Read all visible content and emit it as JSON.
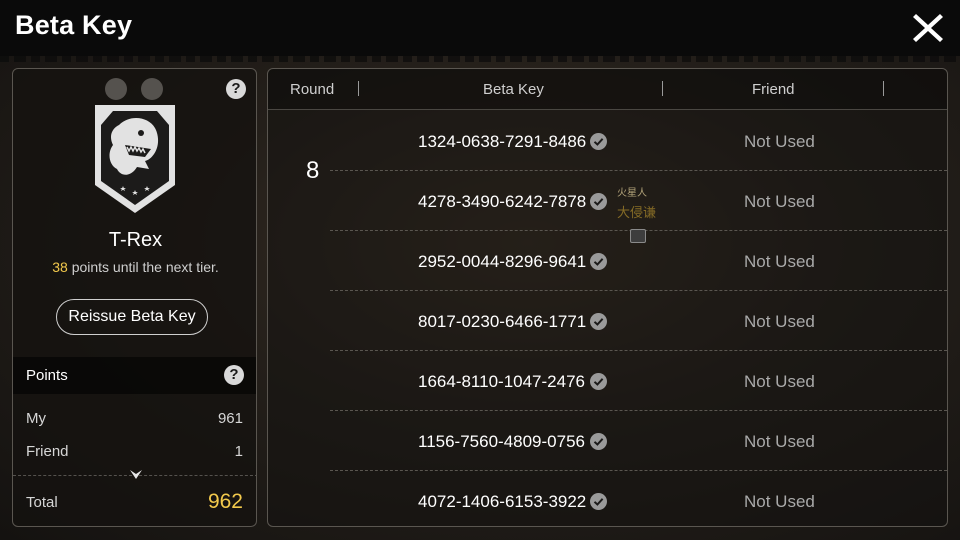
{
  "header": {
    "title": "Beta Key"
  },
  "tier": {
    "name": "T-Rex",
    "points_needed": "38",
    "points_suffix": "points until the next tier.",
    "reissue_label": "Reissue Beta Key"
  },
  "points": {
    "header_label": "Points",
    "my_label": "My",
    "my_value": "961",
    "friend_label": "Friend",
    "friend_value": "1",
    "total_label": "Total",
    "total_value": "962"
  },
  "table": {
    "col_round": "Round",
    "col_key": "Beta Key",
    "col_friend": "Friend",
    "round": "8",
    "rows": [
      {
        "key": "1324-0638-7291-8486",
        "status": "Not Used"
      },
      {
        "key": "4278-3490-6242-7878",
        "status": "Not Used"
      },
      {
        "key": "2952-0044-8296-9641",
        "status": "Not Used"
      },
      {
        "key": "8017-0230-6466-1771",
        "status": "Not Used"
      },
      {
        "key": "1664-8110-1047-2476",
        "status": "Not Used"
      },
      {
        "key": "1156-7560-4809-0756",
        "status": "Not Used"
      },
      {
        "key": "4072-1406-6153-3922",
        "status": "Not Used"
      }
    ]
  },
  "overlay": {
    "line1": "火星人",
    "line2": "大侵谦"
  },
  "colors": {
    "accent_gold": "#f2c94c",
    "muted_text": "#a9a9a9"
  }
}
